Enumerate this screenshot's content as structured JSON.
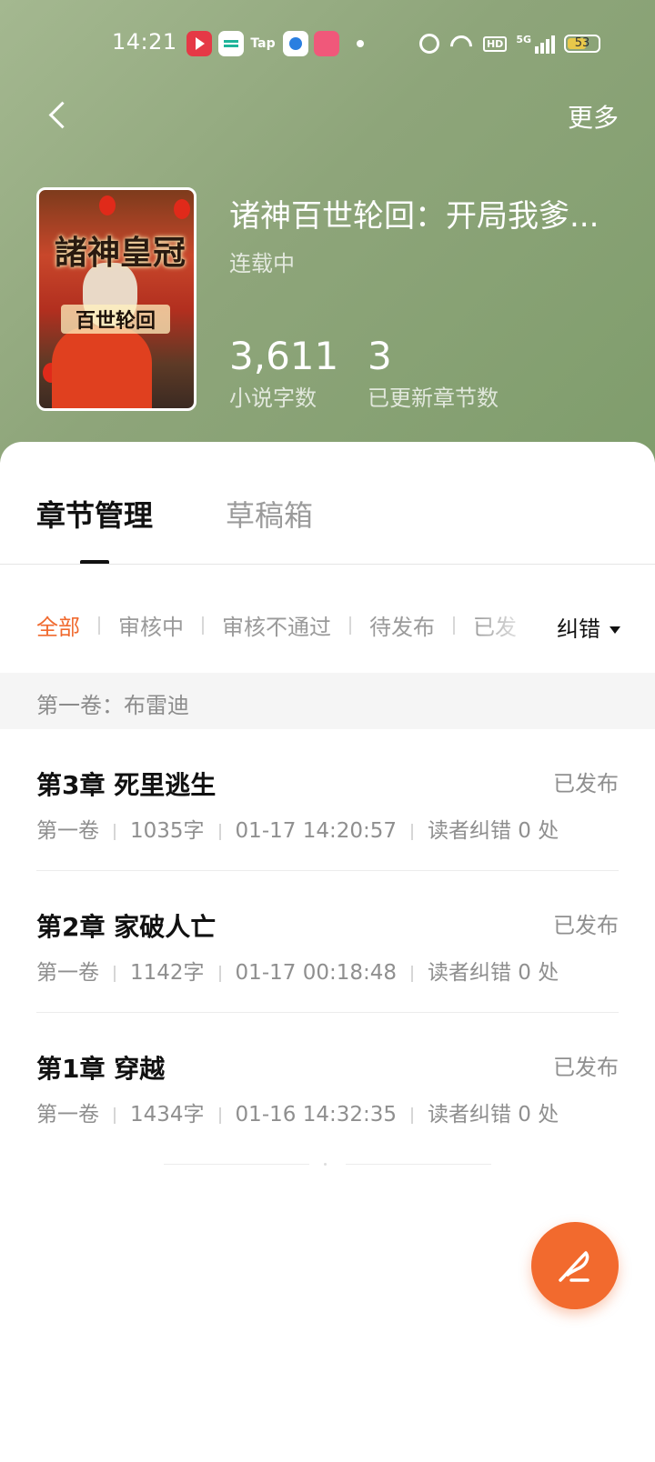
{
  "status_bar": {
    "time": "14:21",
    "tap_label": "Tap",
    "hd_label": "HD",
    "network": "5G",
    "battery": "53"
  },
  "nav": {
    "more_label": "更多"
  },
  "book": {
    "title": "诸神百世轮回：开局我爹...",
    "status": "连载中",
    "cover_title": "諸神皇冠",
    "cover_subtitle": "百世轮回",
    "word_count": "3,611",
    "word_count_label": "小说字数",
    "chapter_count": "3",
    "chapter_count_label": "已更新章节数"
  },
  "tabs": [
    {
      "label": "章节管理",
      "active": true
    },
    {
      "label": "草稿箱",
      "active": false
    }
  ],
  "filters": [
    {
      "label": "全部",
      "active": true
    },
    {
      "label": "审核中",
      "active": false
    },
    {
      "label": "审核不通过",
      "active": false
    },
    {
      "label": "待发布",
      "active": false
    },
    {
      "label": "已发",
      "active": false
    }
  ],
  "correction_label": "纠错",
  "volume": {
    "label": "第一卷：布雷迪"
  },
  "chapters": [
    {
      "title": "第3章 死里逃生",
      "state": "已发布",
      "volume": "第一卷",
      "words": "1035字",
      "time": "01-17 14:20:57",
      "corrections": "读者纠错 0 处"
    },
    {
      "title": "第2章 家破人亡",
      "state": "已发布",
      "volume": "第一卷",
      "words": "1142字",
      "time": "01-17 00:18:48",
      "corrections": "读者纠错 0 处"
    },
    {
      "title": "第1章 穿越",
      "state": "已发布",
      "volume": "第一卷",
      "words": "1434字",
      "time": "01-16 14:32:35",
      "corrections": "读者纠错 0 处"
    }
  ],
  "colors": {
    "accent": "#f26a2e",
    "header_green": "#8ea57a"
  },
  "icons": {
    "back": "chevron-left-icon",
    "dropdown": "caret-down-icon",
    "fab": "quill-pen-icon"
  }
}
